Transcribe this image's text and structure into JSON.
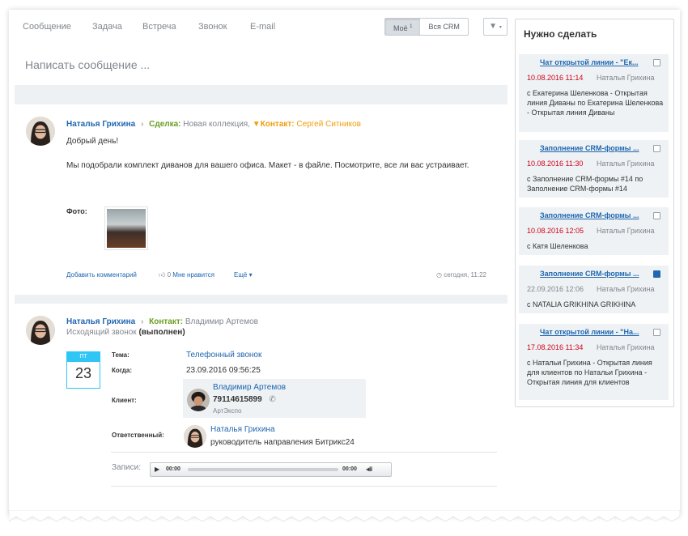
{
  "tabs": [
    "Сообщение",
    "Задача",
    "Встреча",
    "Звонок",
    "E-mail"
  ],
  "filter": {
    "mine": "Моё",
    "mine_count": "1",
    "crm": "Вся CRM"
  },
  "compose_placeholder": "Написать сообщение ...",
  "post1": {
    "author": "Наталья Грихина",
    "deal_label": "Сделка:",
    "deal_value": "Новая коллекция,",
    "contact_label": "Контакт:",
    "contact_value": "Сергей Ситников",
    "greeting": "Добрый день!",
    "body": "Мы подобрали комплект диванов для вашего офиса. Макет - в файле. Посмотрите, все ли вас устраивает.",
    "photo_label": "Фото:",
    "add_comment": "Добавить комментарий",
    "likes": "0",
    "like_label": "Мне нравится",
    "more": "Ещё",
    "time": "сегодня, 11:22"
  },
  "post2": {
    "author": "Наталья Грихина",
    "contact_label": "Контакт:",
    "contact_value": "Владимир Артемов",
    "subtitle": "Исходящий звонок",
    "status": "(выполнен)",
    "cal_day": "ПТ",
    "cal_num": "23",
    "topic_label": "Тема:",
    "topic_value": "Телефонный звонок",
    "when_label": "Когда:",
    "when_value": "23.09.2016 09:56:25",
    "client_label": "Клиент:",
    "client_name": "Владимир Артемов",
    "client_phone": "79114615899",
    "client_company": "АртЭкспо",
    "resp_label": "Ответственный:",
    "resp_name": "Наталья Грихина",
    "resp_title": "руководитель направления Битрикс24",
    "rec_label": "Записи:",
    "rec_start": "00:00",
    "rec_end": "00:00"
  },
  "todo": {
    "title": "Нужно сделать",
    "items": [
      {
        "title": "Чат открытой линии - \"Ек...",
        "date": "10.08.2016 11:14",
        "overdue": true,
        "who": "Наталья Грихина",
        "text": "с Екатерина Шеленкова - Открытая линия Диваны по Екатерина Шеленкова - Открытая линия Диваны",
        "done": false
      },
      {
        "title": "Заполнение CRM-формы ...",
        "date": "10.08.2016 11:30",
        "overdue": true,
        "who": "Наталья Грихина",
        "text": "с Заполнение CRM-формы #14 по Заполнение CRM-формы #14",
        "done": false
      },
      {
        "title": "Заполнение CRM-формы ...",
        "date": "10.08.2016 12:05",
        "overdue": true,
        "who": "Наталья Грихина",
        "text": "с Катя Шеленкова",
        "done": false
      },
      {
        "title": "Заполнение CRM-формы ...",
        "date": "22.09.2016 12:06",
        "overdue": false,
        "who": "Наталья Грихина",
        "text": "с NATALIA GRIKHINA GRIKHINA",
        "done": true
      },
      {
        "title": "Чат открытой линии - \"На...",
        "date": "17.08.2016 11:34",
        "overdue": true,
        "who": "Наталья Грихина",
        "text": "с Натальи Грихина - Открытая линия для клиентов по Натальи Грихина - Открытая линия для клиентов",
        "done": false
      }
    ]
  }
}
